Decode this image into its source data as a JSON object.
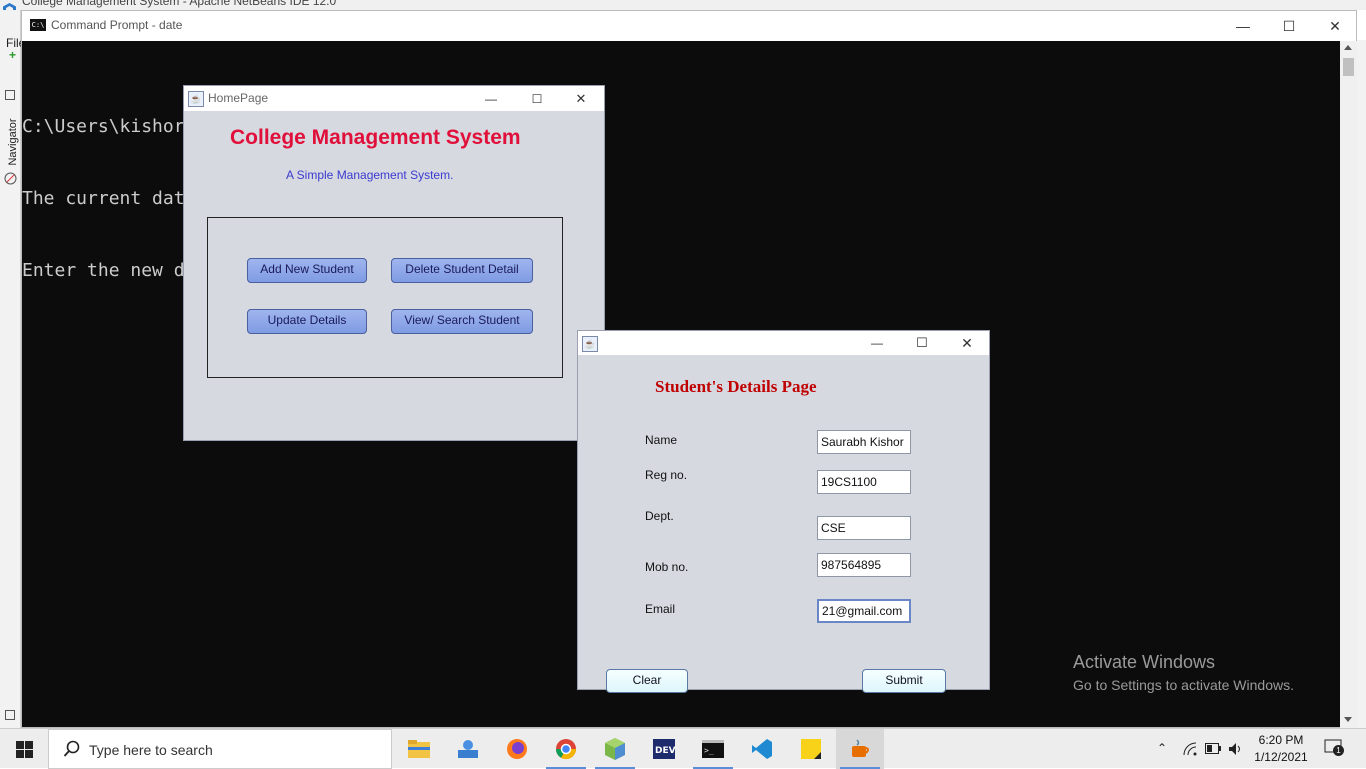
{
  "netbeans": {
    "title": "College Management System - Apache NetBeans IDE 12.0",
    "menu_file": "File",
    "navigator": "Navigator"
  },
  "cmd": {
    "title": "Command Prompt - date",
    "lines": [
      "C:\\Users\\kishor>date",
      "The current dat",
      "Enter the new d"
    ]
  },
  "home": {
    "title": "HomePage",
    "heading": "College Management System",
    "subtitle": "A Simple Management System.",
    "buttons": {
      "add": "Add New Student",
      "delete": "Delete Student Detail",
      "update": "Update Details",
      "view": "View/ Search Student"
    }
  },
  "details": {
    "heading": "Student's Details Page",
    "fields": {
      "name_label": "Name",
      "name_value": "Saurabh Kishor",
      "reg_label": "Reg no.",
      "reg_value": "19CS1100",
      "dept_label": "Dept.",
      "dept_value": "CSE",
      "mob_label": "Mob no.",
      "mob_value": "987564895",
      "email_label": "Email",
      "email_value": "21@gmail.com"
    },
    "clear": "Clear",
    "submit": "Submit"
  },
  "activate": {
    "line1": "Activate Windows",
    "line2": "Go to Settings to activate Windows."
  },
  "taskbar": {
    "search_placeholder": "Type here to search",
    "time": "6:20 PM",
    "date": "1/12/2021",
    "notification_count": "1"
  }
}
